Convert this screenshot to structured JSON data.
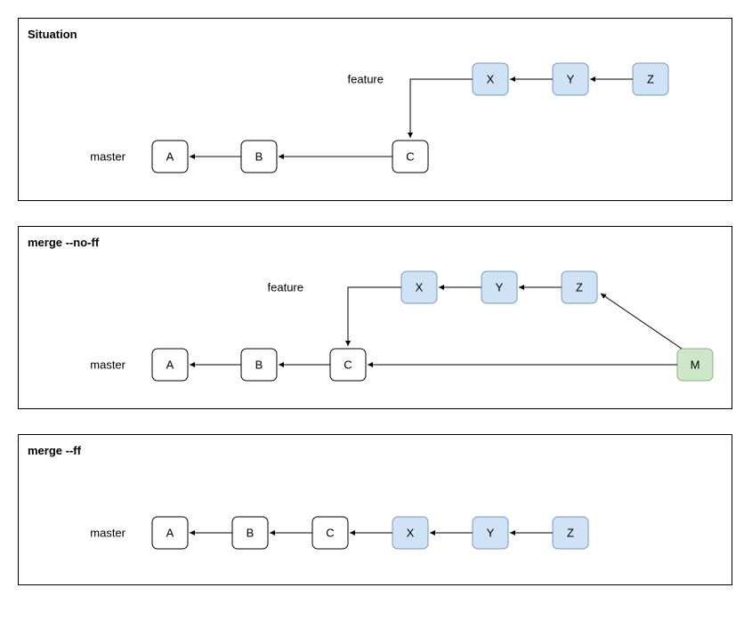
{
  "panels": {
    "p1": {
      "title": "Situation",
      "branch_feature": "feature",
      "branch_master": "master",
      "c_A": "A",
      "c_B": "B",
      "c_C": "C",
      "c_X": "X",
      "c_Y": "Y",
      "c_Z": "Z"
    },
    "p2": {
      "title": "merge --no-ff",
      "branch_feature": "feature",
      "branch_master": "master",
      "c_A": "A",
      "c_B": "B",
      "c_C": "C",
      "c_X": "X",
      "c_Y": "Y",
      "c_Z": "Z",
      "c_M": "M"
    },
    "p3": {
      "title": "merge --ff",
      "branch_master": "master",
      "c_A": "A",
      "c_B": "B",
      "c_C": "C",
      "c_X": "X",
      "c_Y": "Y",
      "c_Z": "Z"
    }
  },
  "colors": {
    "feature_fill": "#d0e2f5",
    "feature_stroke": "#7799bb",
    "merge_fill": "#cde7c8",
    "merge_stroke": "#8bb37f"
  }
}
